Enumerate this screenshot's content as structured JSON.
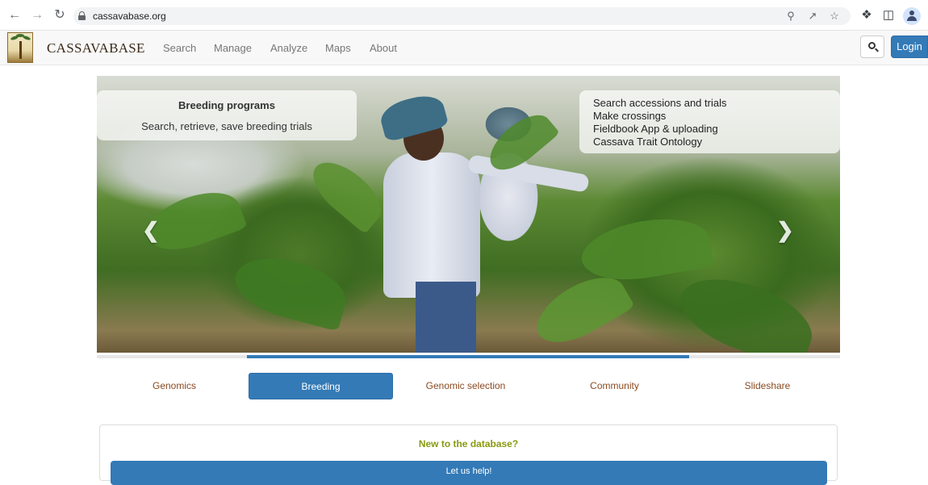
{
  "browser": {
    "url": "cassavabase.org"
  },
  "site": {
    "brand": "CASSAVABASE",
    "menu": [
      "Search",
      "Manage",
      "Analyze",
      "Maps",
      "About"
    ],
    "login_label": "Login"
  },
  "hero": {
    "left_caption": {
      "title": "Breeding programs",
      "subtitle": "Search, retrieve, save breeding trials"
    },
    "right_caption": {
      "lines": [
        "Search accessions and trials",
        "Make crossings",
        "Fieldbook App & uploading",
        "Cassava Trait Ontology"
      ]
    },
    "progress_fraction": 0.6
  },
  "tabs": [
    {
      "label": "Genomics",
      "active": false
    },
    {
      "label": "Breeding",
      "active": true
    },
    {
      "label": "Genomic selection",
      "active": false
    },
    {
      "label": "Community",
      "active": false
    },
    {
      "label": "Slideshare",
      "active": false
    }
  ],
  "panel": {
    "heading": "New to the database?",
    "button_label": "Let us help!"
  },
  "colors": {
    "primary": "#337ab7",
    "tab_text": "#8a4b21",
    "panel_heading": "#8a9a10"
  }
}
